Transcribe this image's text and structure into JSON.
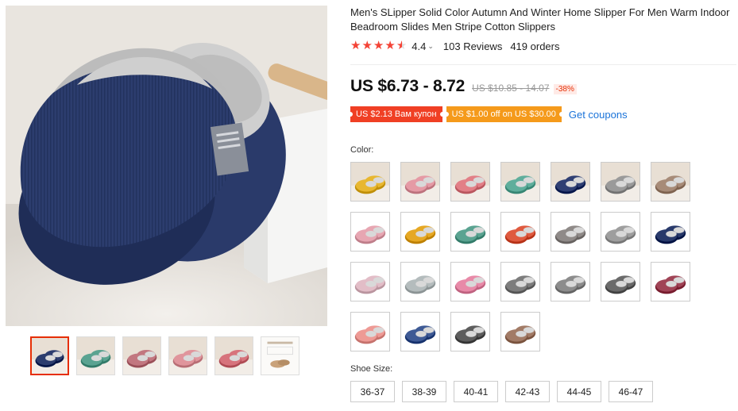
{
  "product": {
    "title": "Men's SLipper Solid Color Autumn And Winter Home Slipper For Men Warm Indoor Beadroom Slides Men Stripe Cotton Slippers",
    "rating": "4.4",
    "rating_value": 4.4,
    "reviews": "103 Reviews",
    "orders": "419 orders"
  },
  "pricing": {
    "price": "US $6.73 - 8.72",
    "old_price": "US $10.85 - 14.07",
    "discount": "-38%"
  },
  "coupons": {
    "items": [
      "US $2.13 Вам купон",
      "US $1.00 off on US $30.00"
    ],
    "link": "Get coupons"
  },
  "colors": {
    "label": "Color:",
    "swatches": [
      {
        "name": "photo-yellow",
        "color": "#e8b730",
        "style": "photo"
      },
      {
        "name": "photo-pink",
        "color": "#e59aa5",
        "style": "photo"
      },
      {
        "name": "photo-rose",
        "color": "#e27f87",
        "style": "photo"
      },
      {
        "name": "photo-green",
        "color": "#5fae9c",
        "style": "photo"
      },
      {
        "name": "photo-navy",
        "color": "#2f3f73",
        "style": "photo"
      },
      {
        "name": "photo-gray",
        "color": "#9a9a9a",
        "style": "photo"
      },
      {
        "name": "photo-brown",
        "color": "#a78b78",
        "style": "photo"
      },
      {
        "name": "pink",
        "color": "#e7a6b2",
        "style": "flat"
      },
      {
        "name": "yellow",
        "color": "#e6a824",
        "style": "flat"
      },
      {
        "name": "green",
        "color": "#5aa391",
        "style": "flat"
      },
      {
        "name": "red",
        "color": "#df5a3f",
        "style": "flat"
      },
      {
        "name": "taupe",
        "color": "#8f8a88",
        "style": "flat"
      },
      {
        "name": "light-gray",
        "color": "#9e9e9e",
        "style": "flat"
      },
      {
        "name": "navy",
        "color": "#293a6b",
        "style": "flat"
      },
      {
        "name": "light-pink",
        "color": "#e2bdc7",
        "style": "flat"
      },
      {
        "name": "silver",
        "color": "#b4bcbd",
        "style": "flat"
      },
      {
        "name": "bright-pink",
        "color": "#e88aa8",
        "style": "flat"
      },
      {
        "name": "dark-gray",
        "color": "#7d7d7d",
        "style": "flat"
      },
      {
        "name": "stone",
        "color": "#8c8c8c",
        "style": "flat"
      },
      {
        "name": "charcoal",
        "color": "#6a6a6a",
        "style": "flat"
      },
      {
        "name": "maroon-stripe",
        "color": "#a04456",
        "style": "flat"
      },
      {
        "name": "coral-stripe",
        "color": "#ee9a95",
        "style": "flat"
      },
      {
        "name": "blue-stripe",
        "color": "#3e5a95",
        "style": "flat"
      },
      {
        "name": "gray-stripe",
        "color": "#5d5d5d",
        "style": "flat"
      },
      {
        "name": "brown-stripe",
        "color": "#a27b66",
        "style": "flat"
      }
    ]
  },
  "sizes": {
    "label": "Shoe Size:",
    "options": [
      "36-37",
      "38-39",
      "40-41",
      "42-43",
      "44-45",
      "46-47"
    ]
  },
  "gallery": {
    "main_color": "#2c3d6e",
    "thumbnails": [
      {
        "name": "navy",
        "color": "#2c3d6e"
      },
      {
        "name": "green",
        "color": "#5aa391"
      },
      {
        "name": "multi",
        "color": "#c27780"
      },
      {
        "name": "pink-closeup",
        "color": "#e0959c"
      },
      {
        "name": "rose",
        "color": "#d7737c"
      },
      {
        "name": "size-chart",
        "color": "#c9a27a"
      }
    ]
  }
}
